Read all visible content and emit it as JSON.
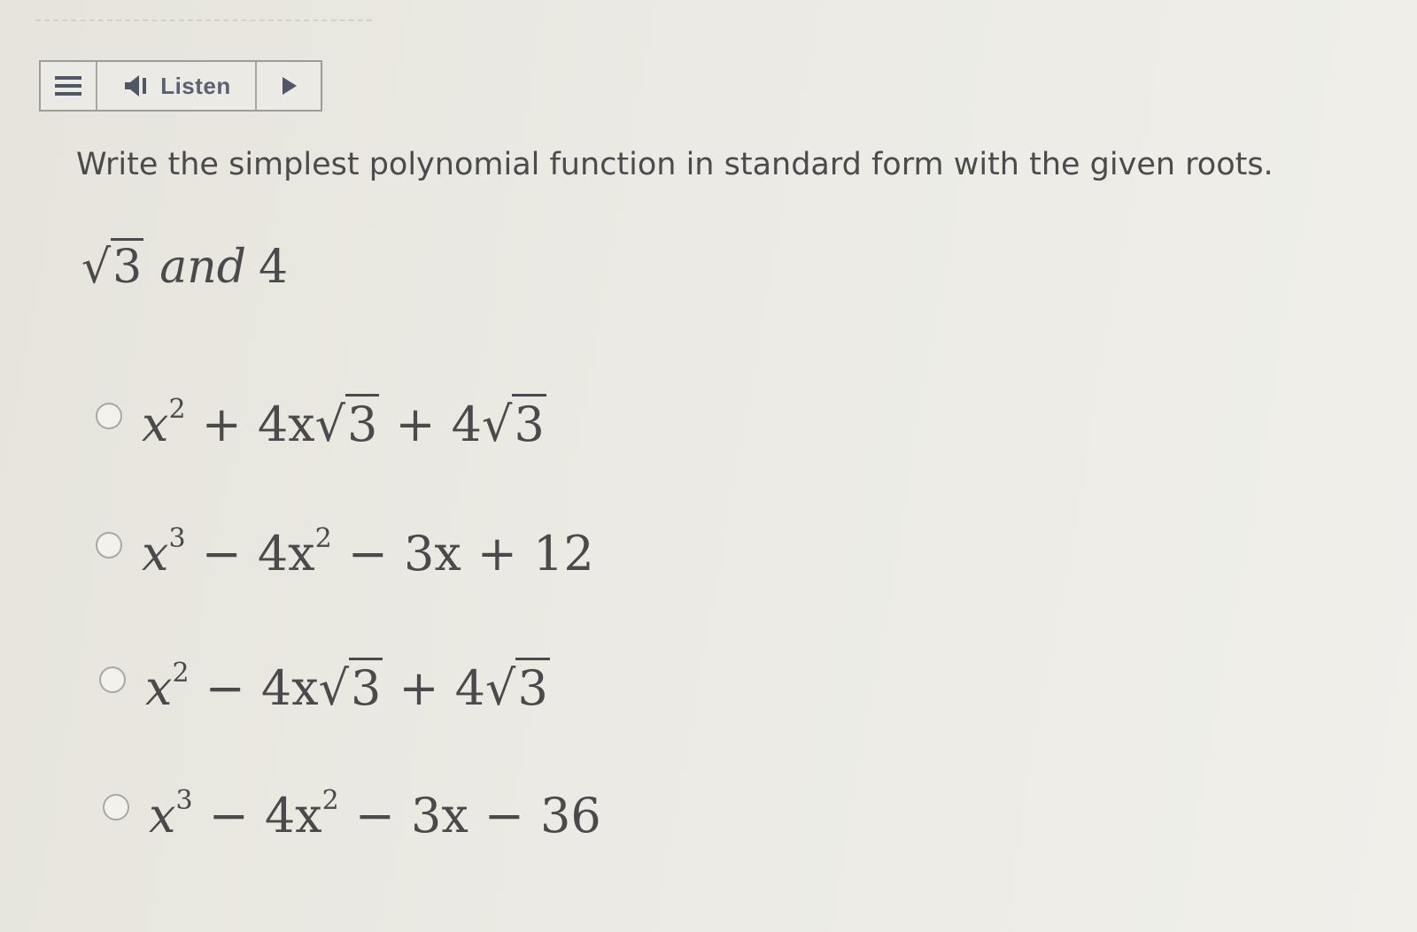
{
  "toolbar": {
    "menu_icon": "hamburger-icon",
    "speaker_icon": "speaker-icon",
    "listen_label": "Listen",
    "play_icon": "play-icon"
  },
  "question": {
    "prompt": "Write the simplest polynomial function in standard form with the given roots.",
    "roots": {
      "first_radicand": "3",
      "connector": "and",
      "second": "4"
    }
  },
  "options": [
    {
      "terms": [
        "x",
        "2",
        "+",
        "4x",
        "3",
        "+",
        "4",
        "3"
      ]
    },
    {
      "terms": [
        "x",
        "3",
        "−",
        "4x",
        "2",
        "−",
        "3x",
        "+",
        "12"
      ]
    },
    {
      "terms": [
        "x",
        "2",
        "−",
        "4x",
        "3",
        "+",
        "4",
        "3"
      ]
    },
    {
      "terms": [
        "x",
        "3",
        "−",
        "4x",
        "2",
        "−",
        "3x",
        "−",
        "36"
      ]
    }
  ],
  "colors": {
    "background": "#ebeae4",
    "text": "#4a4a4c",
    "toolbar_text": "#5a6172",
    "border": "#9c9c98"
  }
}
